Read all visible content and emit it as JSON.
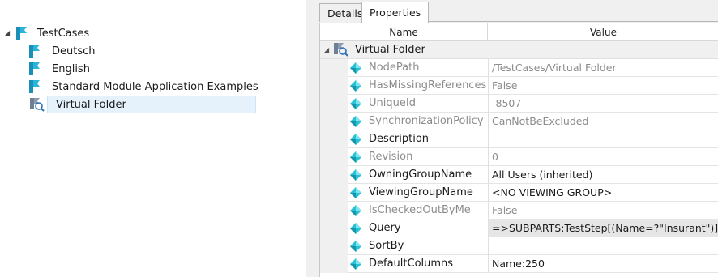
{
  "tree": {
    "root": {
      "label": "TestCases",
      "icon": "testcases-folder-icon"
    },
    "children": [
      {
        "label": "Deutsch",
        "icon": "testcases-folder-icon"
      },
      {
        "label": "English",
        "icon": "testcases-folder-icon"
      },
      {
        "label": "Standard Module Application Examples",
        "icon": "testcases-folder-icon"
      },
      {
        "label": "Virtual Folder",
        "icon": "virtual-folder-icon",
        "selected": true
      }
    ]
  },
  "tabs": [
    {
      "label": "Details",
      "active": false
    },
    {
      "label": "Properties",
      "active": true
    }
  ],
  "grid": {
    "header_name": "Name",
    "header_value": "Value",
    "group_label": "Virtual Folder",
    "properties": [
      {
        "name": "NodePath",
        "value": "/TestCases/Virtual Folder",
        "readonly": true
      },
      {
        "name": "HasMissingReferences",
        "value": "False",
        "readonly": true
      },
      {
        "name": "UniqueId",
        "value": "-8507",
        "readonly": true
      },
      {
        "name": "SynchronizationPolicy",
        "value": "CanNotBeExcluded",
        "readonly": true
      },
      {
        "name": "Description",
        "value": "",
        "readonly": false
      },
      {
        "name": "Revision",
        "value": "0",
        "readonly": true
      },
      {
        "name": "OwningGroupName",
        "value": "All Users (inherited)",
        "readonly": false
      },
      {
        "name": "ViewingGroupName",
        "value": "<NO VIEWING GROUP>",
        "readonly": false
      },
      {
        "name": "IsCheckedOutByMe",
        "value": "False",
        "readonly": true
      },
      {
        "name": "Query",
        "value": "=>SUBPARTS:TestStep[(Name=?\"Insurant\")]",
        "readonly": false,
        "highlighted": true
      },
      {
        "name": "SortBy",
        "value": "",
        "readonly": false
      },
      {
        "name": "DefaultColumns",
        "value": "Name:250",
        "readonly": false
      }
    ]
  },
  "colors": {
    "selection": "#e5f1fb",
    "folder_icon": "#1aa5c8",
    "diamond_icon": "#27c2d6"
  }
}
